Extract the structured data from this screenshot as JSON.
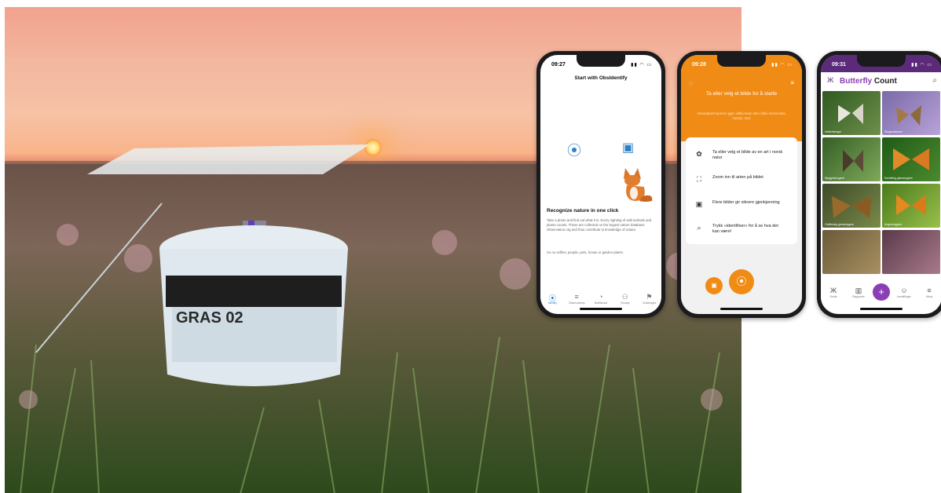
{
  "photo": {
    "trap_label": "GRAS 02"
  },
  "phones": {
    "obsidentify": {
      "time": "09:27",
      "header": "Start with ObsIdentify",
      "title": "Recognize nature in one click",
      "body": "Take a photo and find out what it is. Every sighting of wild animals and plants counts. These are collected on the largest nature database Observation.org and thus contribute to knowledge of nature.",
      "note": "So no selfies, people, pets, house or garden plants.",
      "nav": [
        {
          "label": "Identify",
          "icon": "camera-icon"
        },
        {
          "label": "Observations",
          "icon": "list-icon"
        },
        {
          "label": "Notifiscard",
          "icon": "bell-icon"
        },
        {
          "label": "Groups",
          "icon": "group-icon"
        },
        {
          "label": "Challenges",
          "icon": "flag-icon"
        }
      ]
    },
    "artsorakel": {
      "time": "09:28",
      "title": "Ta eller velg et bilde for å starte",
      "subtitle": "Artsorakelet kjenner igjen viltlevende arter (ikke mennesker, husdyr, osv)",
      "tips": [
        {
          "icon": "bug-icon",
          "text": "Ta eller velg et bilde av en art i norsk natur"
        },
        {
          "icon": "zoom-icon",
          "text": "Zoom inn til arten på bildet"
        },
        {
          "icon": "images-icon",
          "text": "Flere bilder gir sikrere gjenkjenning"
        },
        {
          "icon": "search-icon",
          "text": "Trykk «identifiser» for å se hva det kan være!"
        }
      ]
    },
    "butterfly_count": {
      "time": "09:31",
      "title_part1": "Butterfly",
      "title_part2": "Count",
      "tiles": [
        {
          "caption": "Hvithvitvinget",
          "color": "#4a6a33"
        },
        {
          "caption": "Skogsvoksene",
          "color": "#6c5a8a"
        },
        {
          "caption": "Sjeggelsmygere",
          "color": "#3d6a2a"
        },
        {
          "caption": "Sorrtlekig glansmygere",
          "color": "#2f6a1f"
        },
        {
          "caption": "Gullfleckig glansmygere",
          "color": "#4e5a30"
        },
        {
          "caption": "Anglesmygere",
          "color": "#5f7a2a"
        },
        {
          "caption": "",
          "color": "#7a6a4a"
        },
        {
          "caption": "",
          "color": "#6a4a5a"
        }
      ],
      "nav": [
        {
          "label": "Guide",
          "icon": "butterfly-icon"
        },
        {
          "label": "Rapporter",
          "icon": "chart-icon"
        },
        {
          "label": "Innstillinger",
          "icon": "user-icon"
        },
        {
          "label": "Meny",
          "icon": "menu-icon"
        }
      ]
    }
  }
}
